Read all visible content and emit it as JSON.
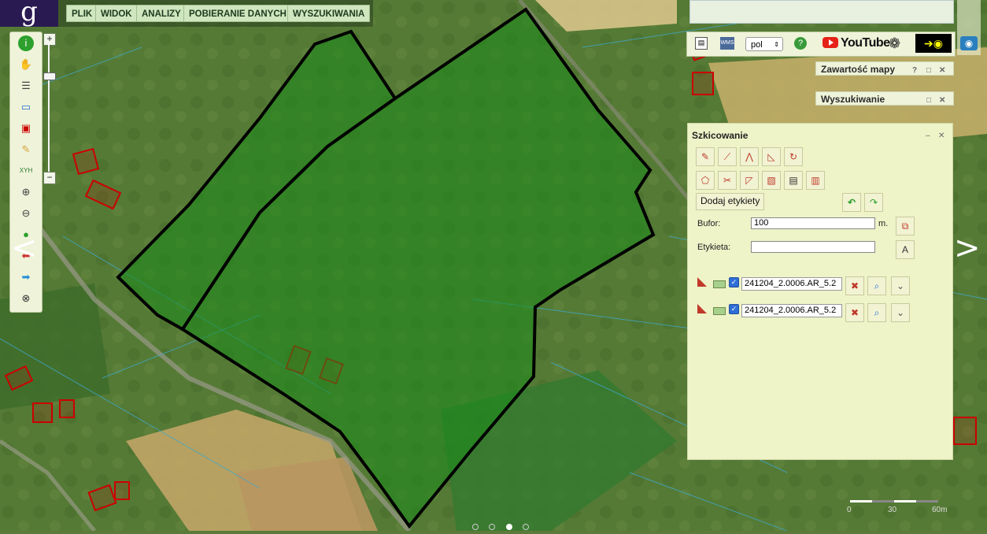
{
  "menu": {
    "logo": "g",
    "items": [
      {
        "label": "PLIK"
      },
      {
        "label": "WIDOK"
      },
      {
        "label": "ANALIZY"
      },
      {
        "label": "POBIERANIE DANYCH"
      },
      {
        "label": "WYSZUKIWANIA"
      }
    ]
  },
  "topbar": {
    "language": "pol",
    "youtube_label": "YouTube"
  },
  "panels": {
    "map_content": "Zawartość mapy",
    "search": "Wyszukiwanie"
  },
  "sketch": {
    "title": "Szkicowanie",
    "add_labels_button": "Dodaj etykiety",
    "buffer_label": "Bufor:",
    "buffer_value": "100",
    "buffer_unit": "m.",
    "label_label": "Etykieta:",
    "label_value": "",
    "layers": [
      {
        "name": "241204_2.0006.AR_5.2",
        "checked": true
      },
      {
        "name": "241204_2.0006.AR_5.2",
        "checked": true
      }
    ]
  },
  "scale": {
    "labels": [
      "0",
      "30",
      "60m"
    ]
  },
  "carousel": {
    "count": 4,
    "active_index": 2
  },
  "colors": {
    "parcel_outline": "#000000",
    "parcel_fill": "#1a8a1a",
    "building": "#cc0000",
    "cadastral_lines": "#3fa7c9"
  }
}
